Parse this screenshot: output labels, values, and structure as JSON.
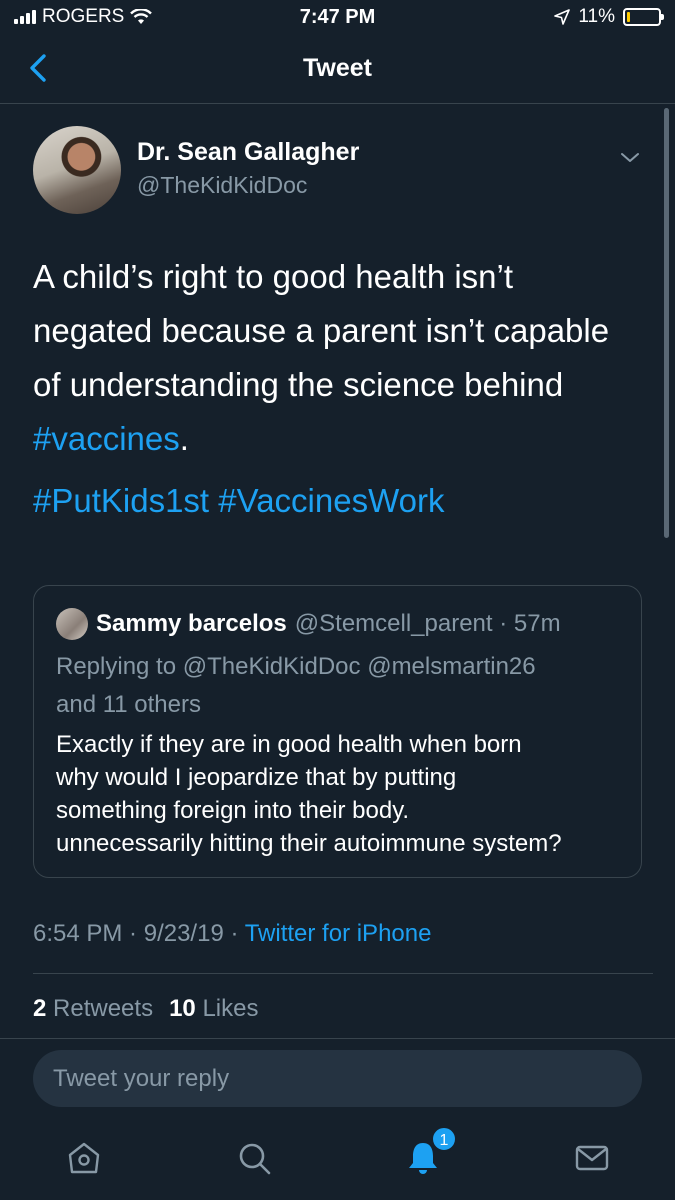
{
  "status_bar": {
    "carrier": "ROGERS",
    "time": "7:47 PM",
    "battery": "11%",
    "battery_level": 0.11,
    "battery_color": "#ffcc00"
  },
  "nav": {
    "title": "Tweet",
    "back_icon": "chevron-left-icon"
  },
  "tweet": {
    "author_name": "Dr. Sean Gallagher",
    "author_handle": "@TheKidKidDoc",
    "text_line1": "A child’s right to good health isn’t",
    "text_line2": "negated because a parent isn’t capable",
    "text_line3": "of understanding the science behind",
    "text_hashtag": "#vaccines",
    "text_period": ".",
    "tag1": "#PutKids1st",
    "tag2": "#VaccinesWork",
    "time": "6:54 PM",
    "date": "9/23/19",
    "source": "Twitter for iPhone",
    "retweets_count": "2",
    "retweets_label": "Retweets",
    "likes_count": "10",
    "likes_label": "Likes"
  },
  "quote": {
    "name": "Sammy barcelos",
    "handle": "@Stemcell_parent",
    "age": "57m",
    "reply_prefix": "Replying to",
    "reply_to1": "@TheKidKidDoc",
    "reply_to2": "@melsmartin26",
    "reply_others": "and 11 others",
    "body_line1": "Exactly if they are in good health when born",
    "body_line2": "why would I jeopardize that by putting",
    "body_line3": "something foreign into their body.",
    "body_line4": "unnecessarily hitting their autoimmune system?"
  },
  "reply_placeholder": "Tweet your reply",
  "tab_bar": {
    "notifications_badge": "1",
    "accent_color": "#1da1f2"
  }
}
